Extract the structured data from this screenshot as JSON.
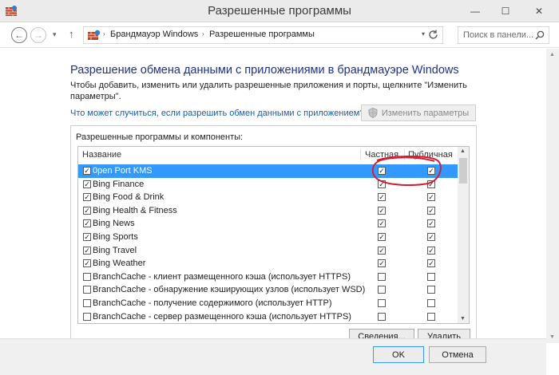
{
  "window": {
    "title": "Разрешенные программы",
    "minimize_glyph": "—",
    "maximize_glyph": "☐",
    "close_glyph": "✕"
  },
  "navigation": {
    "back_glyph": "←",
    "forward_glyph": "→",
    "recent_glyph": "▾",
    "up_glyph": "↑",
    "breadcrumb": [
      "Брандмауэр Windows",
      "Разрешенные программы"
    ],
    "separator": "›",
    "dropdown_glyph": "▾",
    "search_placeholder": "Поиск в панели..."
  },
  "main": {
    "heading": "Разрешение обмена данными с приложениями в брандмауэре Windows",
    "description": "Чтобы добавить, изменить или удалить разрешенные приложения и порты, щелкните \"Изменить параметры\".",
    "risk_link": "Что может случиться, если разрешить обмен данными с приложением?",
    "change_settings_label": "Изменить параметры",
    "group_title": "Разрешенные программы и компоненты:",
    "columns": {
      "name": "Название",
      "private": "Частная",
      "public": "Публичная"
    },
    "rows": [
      {
        "name": "0pen Port KMS",
        "enabled": "✓",
        "private": "✓",
        "public": "✓",
        "selected": true
      },
      {
        "name": "Bing Finance",
        "enabled": "✓",
        "private": "✓",
        "public": "✓"
      },
      {
        "name": "Bing Food & Drink",
        "enabled": "✓",
        "private": "✓",
        "public": "✓"
      },
      {
        "name": "Bing Health & Fitness",
        "enabled": "✓",
        "private": "✓",
        "public": "✓"
      },
      {
        "name": "Bing News",
        "enabled": "✓",
        "private": "✓",
        "public": "✓"
      },
      {
        "name": "Bing Sports",
        "enabled": "✓",
        "private": "✓",
        "public": "✓"
      },
      {
        "name": "Bing Travel",
        "enabled": "✓",
        "private": "✓",
        "public": "✓"
      },
      {
        "name": "Bing Weather",
        "enabled": "✓",
        "private": "✓",
        "public": "✓"
      },
      {
        "name": "BranchCache - клиент размещенного кэша (использует HTTPS)",
        "enabled": "",
        "private": "",
        "public": ""
      },
      {
        "name": "BranchCache - обнаружение кэширующих узлов (использует WSD)",
        "enabled": "",
        "private": "",
        "public": ""
      },
      {
        "name": "BranchCache - получение содержимого (использует HTTP)",
        "enabled": "",
        "private": "",
        "public": ""
      },
      {
        "name": "BranchCache - сервер размещенного кэша (использует HTTPS)",
        "enabled": "",
        "private": "",
        "public": ""
      }
    ],
    "details_label": "Сведения...",
    "remove_label": "Удалить"
  },
  "footer": {
    "ok_label": "OK",
    "cancel_label": "Отмена"
  },
  "colors": {
    "heading": "#1e3287",
    "link": "#1a5dab",
    "selection": "#3399ff",
    "annotation": "#d21e32"
  }
}
